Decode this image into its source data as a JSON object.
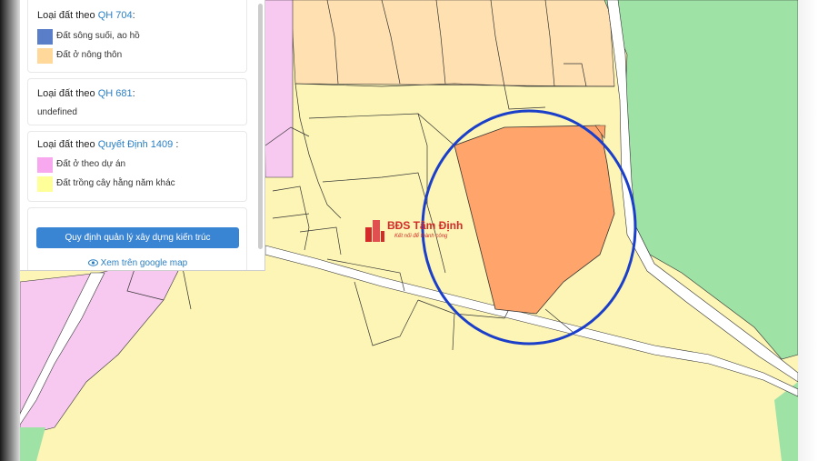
{
  "panel": {
    "card1": {
      "title_prefix": "Loại đất theo",
      "title_link": "QH 704",
      "title_suffix": ":",
      "legend": [
        {
          "label": "Đất sông suối, ao hồ",
          "color": "#5b7ec9"
        },
        {
          "label": "Đất ở nông thôn",
          "color": "#ffd89a"
        }
      ]
    },
    "card2": {
      "title_prefix": "Loại đất theo",
      "title_link": "QH 681",
      "title_suffix": ":",
      "value": "undefined"
    },
    "card3": {
      "title_prefix": "Loại đất theo",
      "title_link": "Quyết Định 1409",
      "title_suffix": ":",
      "legend": [
        {
          "label": "Đất ở theo dự án",
          "color": "#f7a8ee"
        },
        {
          "label": "Đất trồng cây hằng năm khác",
          "color": "#ffff99"
        }
      ]
    },
    "rule_button": "Quy định quản lý xây dựng kiến trúc",
    "google_link": "Xem trên google map",
    "google_icon": "eye-icon"
  },
  "watermark": {
    "title": "BĐS Tâm Định",
    "subtitle": "Kết nối để thành công",
    "icon": "building-icon"
  },
  "map": {
    "colors": {
      "rural_residential": "#ffe0b0",
      "annual_crops": "#fcf5b5",
      "project_residential": "#f7c9f0",
      "forest": "#9ee2a6",
      "road": "#ffffff",
      "highlight_parcel": "#ffa56b",
      "annotation_circle": "#1c3fc9"
    }
  }
}
